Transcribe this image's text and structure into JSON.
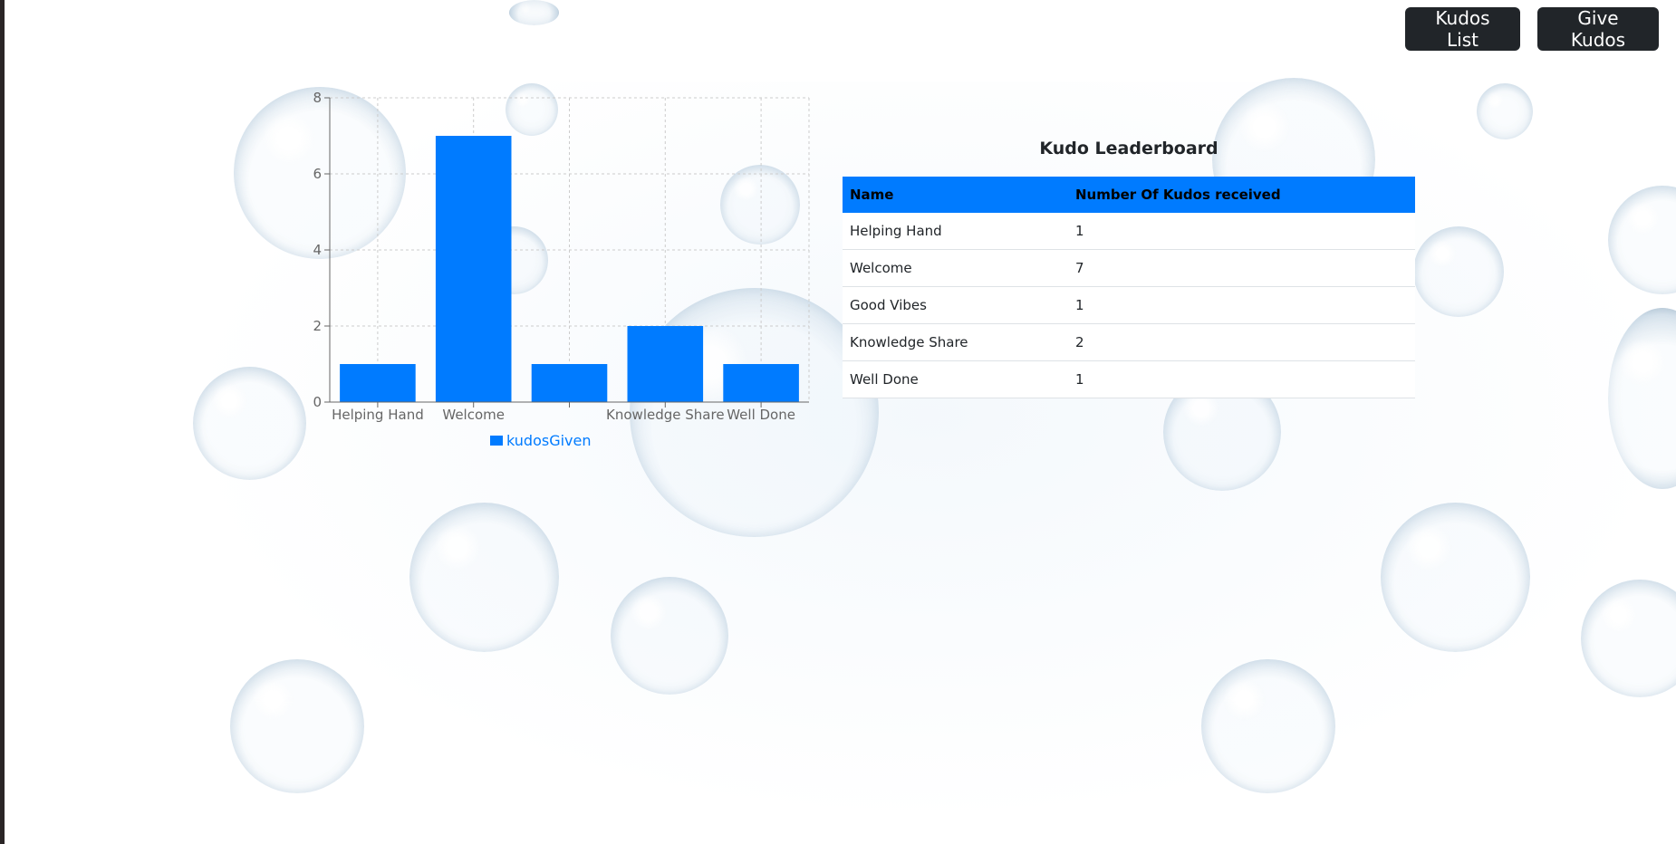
{
  "nav": {
    "kudos_list_label": "Kudos List",
    "give_kudos_label": "Give Kudos"
  },
  "leaderboard": {
    "title": "Kudo Leaderboard",
    "columns": [
      "Name",
      "Number Of Kudos received"
    ],
    "rows": [
      {
        "name": "Helping Hand",
        "count": "1"
      },
      {
        "name": "Welcome",
        "count": "7"
      },
      {
        "name": "Good Vibes",
        "count": "1"
      },
      {
        "name": "Knowledge Share",
        "count": "2"
      },
      {
        "name": "Well Done",
        "count": "1"
      }
    ]
  },
  "chart_data": {
    "type": "bar",
    "categories": [
      "Helping Hand",
      "Welcome",
      "Good Vibes",
      "Knowledge Share",
      "Well Done"
    ],
    "visible_tick_labels": [
      "Helping Hand",
      "Welcome",
      "",
      "Knowledge Share",
      "Well Done"
    ],
    "series": [
      {
        "name": "kudosGiven",
        "values": [
          1,
          7,
          1,
          2,
          1
        ],
        "color": "#007bff"
      }
    ],
    "yticks": [
      0,
      2,
      4,
      6,
      8
    ],
    "ylim": [
      0,
      8
    ],
    "grid": true,
    "legend": "bottom-center",
    "title": "",
    "xlabel": "",
    "ylabel": ""
  },
  "colors": {
    "accent": "#007bff",
    "button_bg": "#212529",
    "button_text": "#ffffff"
  }
}
